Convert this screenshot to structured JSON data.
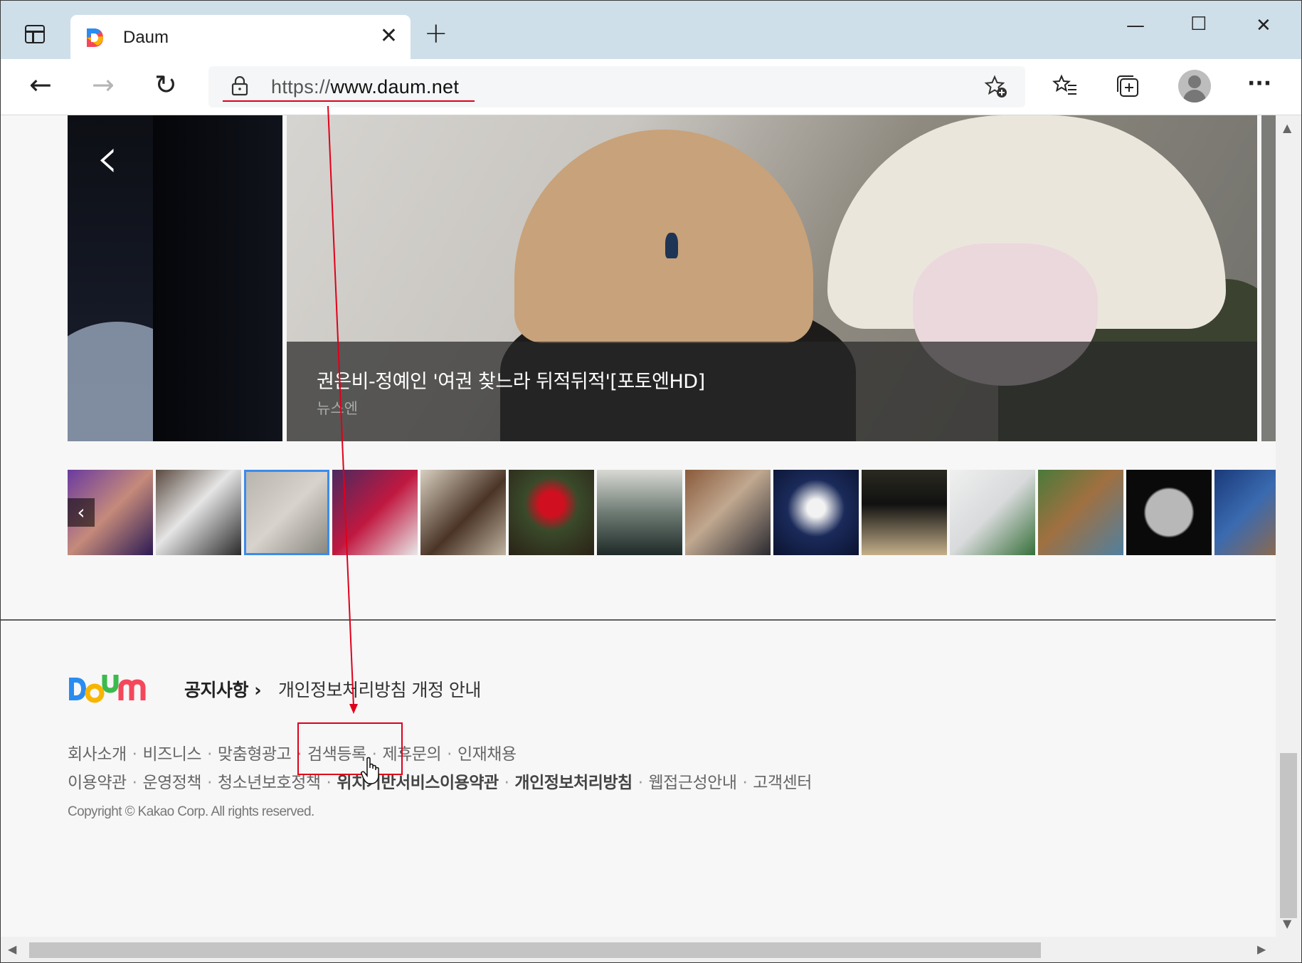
{
  "browser": {
    "tab_title": "Daum",
    "tab_close": "✕",
    "new_tab": "+",
    "window_controls": {
      "minimize": "—",
      "maximize": "☐",
      "close": "✕"
    },
    "nav": {
      "back": "←",
      "forward": "→",
      "reload": "↻"
    },
    "address": {
      "scheme": "https://",
      "host": "www.daum.net"
    },
    "toolbar_icons": [
      "favorites-add-icon",
      "favorites-icon",
      "collections-icon",
      "profile-icon",
      "more-icon"
    ],
    "more_label": "···",
    "favorites_label": "☆≡",
    "collections_label": "⧉"
  },
  "slider": {
    "prev_arrow": "‹",
    "caption_title": "권은비-정예인 '여권 찾느라 뒤적뒤적'[포토엔HD]",
    "caption_source": "뉴스엔",
    "thumb_prev": "‹",
    "thumbnail_count": 14,
    "selected_thumbnail": 3
  },
  "footer": {
    "notice_label": "공지사항 ›",
    "notice_link": "개인정보처리방침 개정 안내",
    "links_row1": [
      "회사소개",
      "비즈니스",
      "맞춤형광고",
      "검색등록",
      "제휴문의",
      "인재채용"
    ],
    "links_row2": [
      "이용약관",
      "운영정책",
      "청소년보호정책",
      "위치기반서비스이용약관",
      "개인정보처리방침",
      "웹접근성안내",
      "고객센터"
    ],
    "links_row2_bold": [
      "위치기반서비스이용약관",
      "개인정보처리방침"
    ],
    "copyright": "Copyright © Kakao Corp. All rights reserved."
  },
  "colors": {
    "accent_annotation": "#e0001a",
    "selected_thumb": "#3b8beb",
    "daum_blue": "#2a8cf0",
    "daum_yellow": "#f7b500",
    "daum_green": "#3dba4e",
    "daum_red": "#f5475b"
  }
}
